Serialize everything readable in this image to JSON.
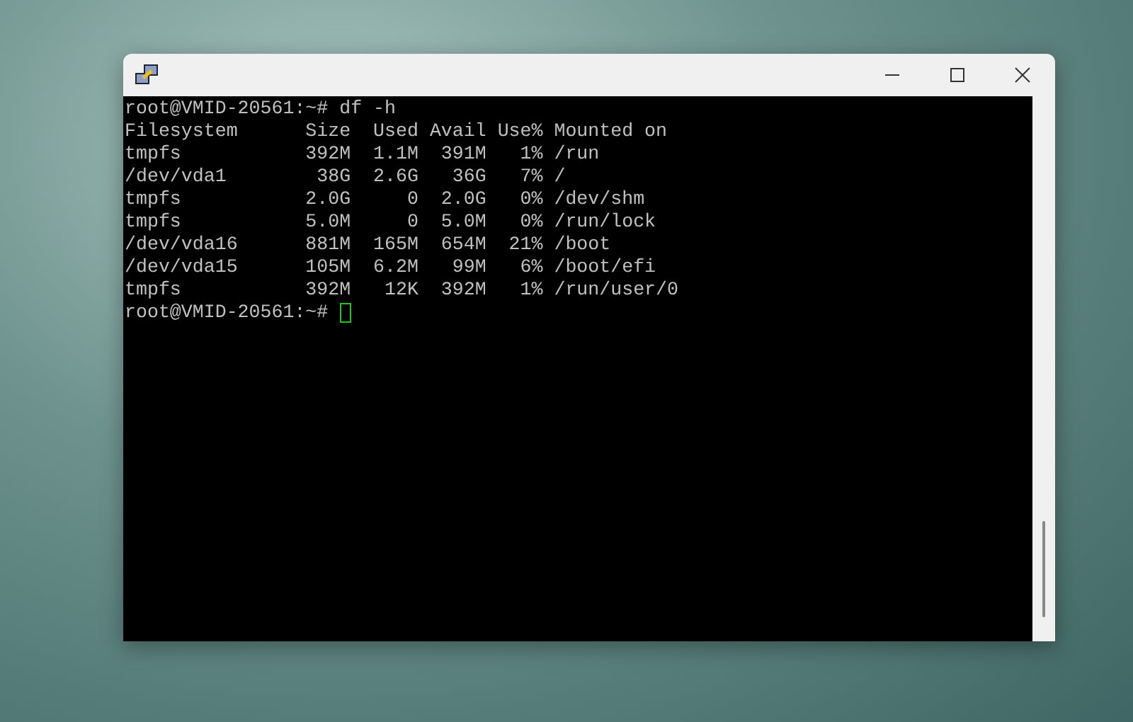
{
  "terminal": {
    "lines": [
      "root@VMID-20561:~# df -h",
      "Filesystem      Size  Used Avail Use% Mounted on",
      "tmpfs           392M  1.1M  391M   1% /run",
      "/dev/vda1        38G  2.6G   36G   7% /",
      "tmpfs           2.0G     0  2.0G   0% /dev/shm",
      "tmpfs           5.0M     0  5.0M   0% /run/lock",
      "/dev/vda16      881M  165M  654M  21% /boot",
      "/dev/vda15      105M  6.2M   99M   6% /boot/efi",
      "tmpfs           392M   12K  392M   1% /run/user/0"
    ],
    "prompt": "root@VMID-20561:~#",
    "cursor_visible": true
  }
}
